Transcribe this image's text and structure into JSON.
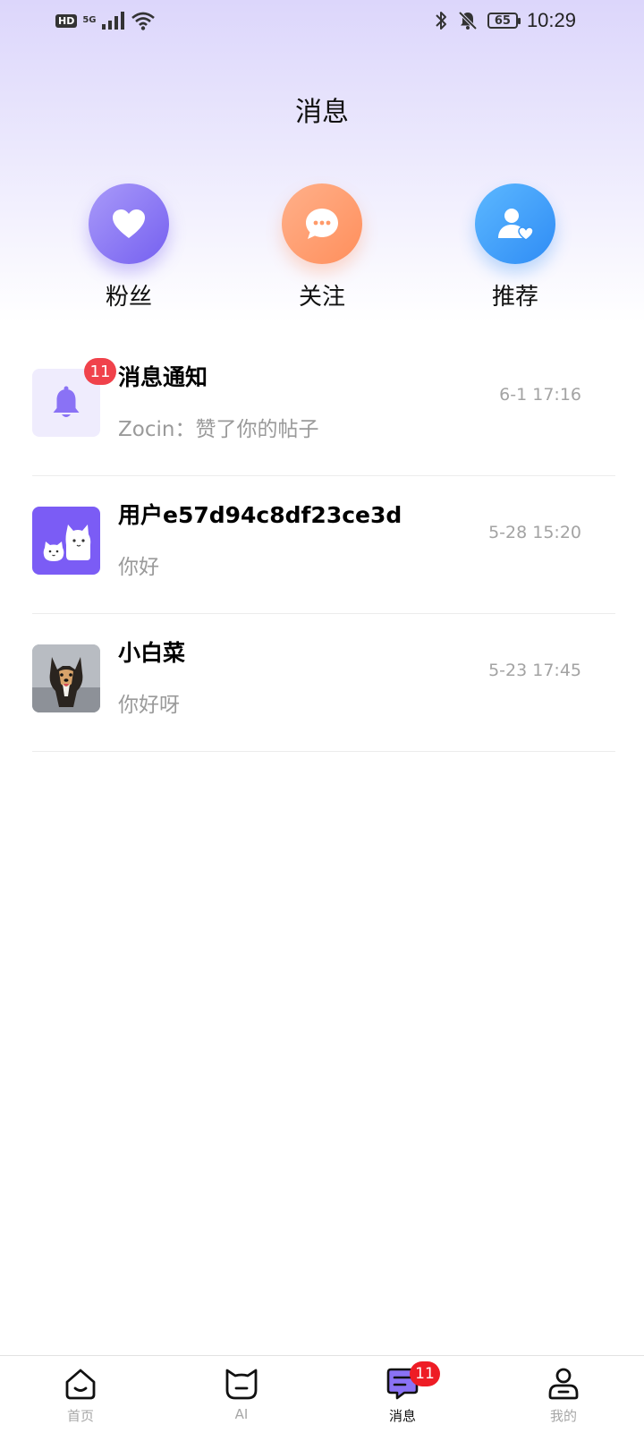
{
  "status_bar": {
    "hd": "HD",
    "network": "5G",
    "battery": "65",
    "time": "10:29"
  },
  "header": {
    "title": "消息"
  },
  "quick_actions": [
    {
      "label": "粉丝",
      "icon": "heart-icon"
    },
    {
      "label": "关注",
      "icon": "chat-bubble-icon"
    },
    {
      "label": "推荐",
      "icon": "user-heart-icon"
    }
  ],
  "conversations": [
    {
      "name": "消息通知",
      "preview": "Zocin：赞了你的帖子",
      "time": "6-1 17:16",
      "badge": "11",
      "avatar": "bell-icon"
    },
    {
      "name": "用户e57d94c8df23ce3d",
      "preview": "你好",
      "time": "5-28 15:20",
      "avatar": "cats-avatar"
    },
    {
      "name": "小白菜",
      "preview": "你好呀",
      "time": "5-23 17:45",
      "avatar": "dog-photo-avatar"
    }
  ],
  "tabbar": {
    "items": [
      {
        "label": "首页",
        "icon": "home-icon"
      },
      {
        "label": "AI",
        "icon": "cat-face-icon"
      },
      {
        "label": "消息",
        "icon": "message-icon",
        "badge": "11",
        "active": true
      },
      {
        "label": "我的",
        "icon": "profile-icon"
      }
    ]
  },
  "colors": {
    "accent": "#7560f0",
    "badge": "#f0424b",
    "follow": "#ff8f5c",
    "recommend": "#2f8cf5"
  }
}
